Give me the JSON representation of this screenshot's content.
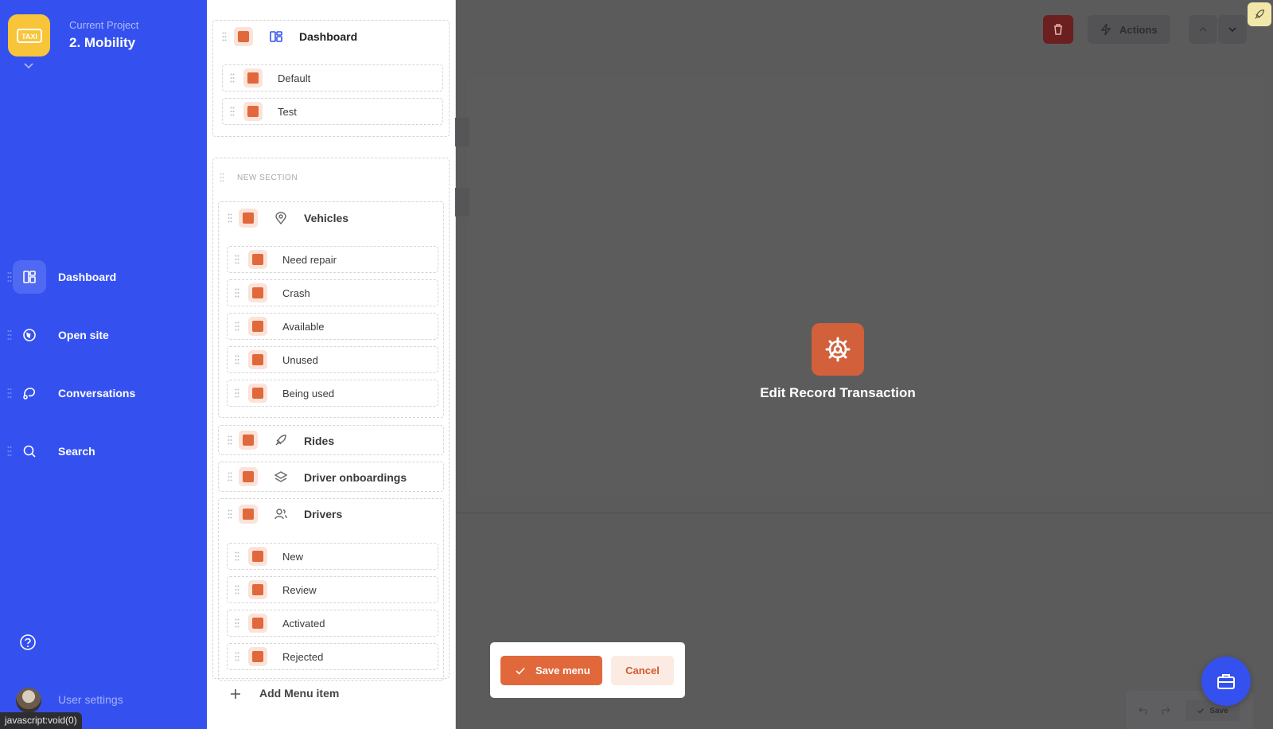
{
  "project": {
    "label": "Current Project",
    "name": "2. Mobility"
  },
  "sidebar": {
    "items": [
      {
        "label": "Dashboard",
        "icon": "dashboard-icon",
        "active": true
      },
      {
        "label": "Open site",
        "icon": "globe-icon"
      },
      {
        "label": "Conversations",
        "icon": "chat-icon"
      },
      {
        "label": "Search",
        "icon": "search-icon"
      }
    ],
    "user_settings": "User settings",
    "status_url": "javascript:void(0)"
  },
  "menu": {
    "dashboard": {
      "label": "Dashboard",
      "children": [
        "Default",
        "Test"
      ]
    },
    "section_title": "NEW SECTION",
    "vehicles": {
      "label": "Vehicles",
      "children": [
        "Need repair",
        "Crash",
        "Available",
        "Unused",
        "Being used"
      ]
    },
    "rides": {
      "label": "Rides"
    },
    "driver_onboardings": {
      "label": "Driver onboardings"
    },
    "drivers": {
      "label": "Drivers",
      "children": [
        "New",
        "Review",
        "Activated",
        "Rejected"
      ]
    },
    "add_item": "Add Menu item"
  },
  "toolbar": {
    "actions_label": "Actions"
  },
  "main": {
    "edit_title": "Edit Record Transaction"
  },
  "dialog": {
    "save_label": "Save menu",
    "cancel_label": "Cancel"
  },
  "bottom": {
    "save_label": "Save"
  },
  "colors": {
    "sidebar": "#3451f0",
    "accent": "#e1683b",
    "overlay": "#5b5b5c",
    "logo": "#f8c53a"
  }
}
